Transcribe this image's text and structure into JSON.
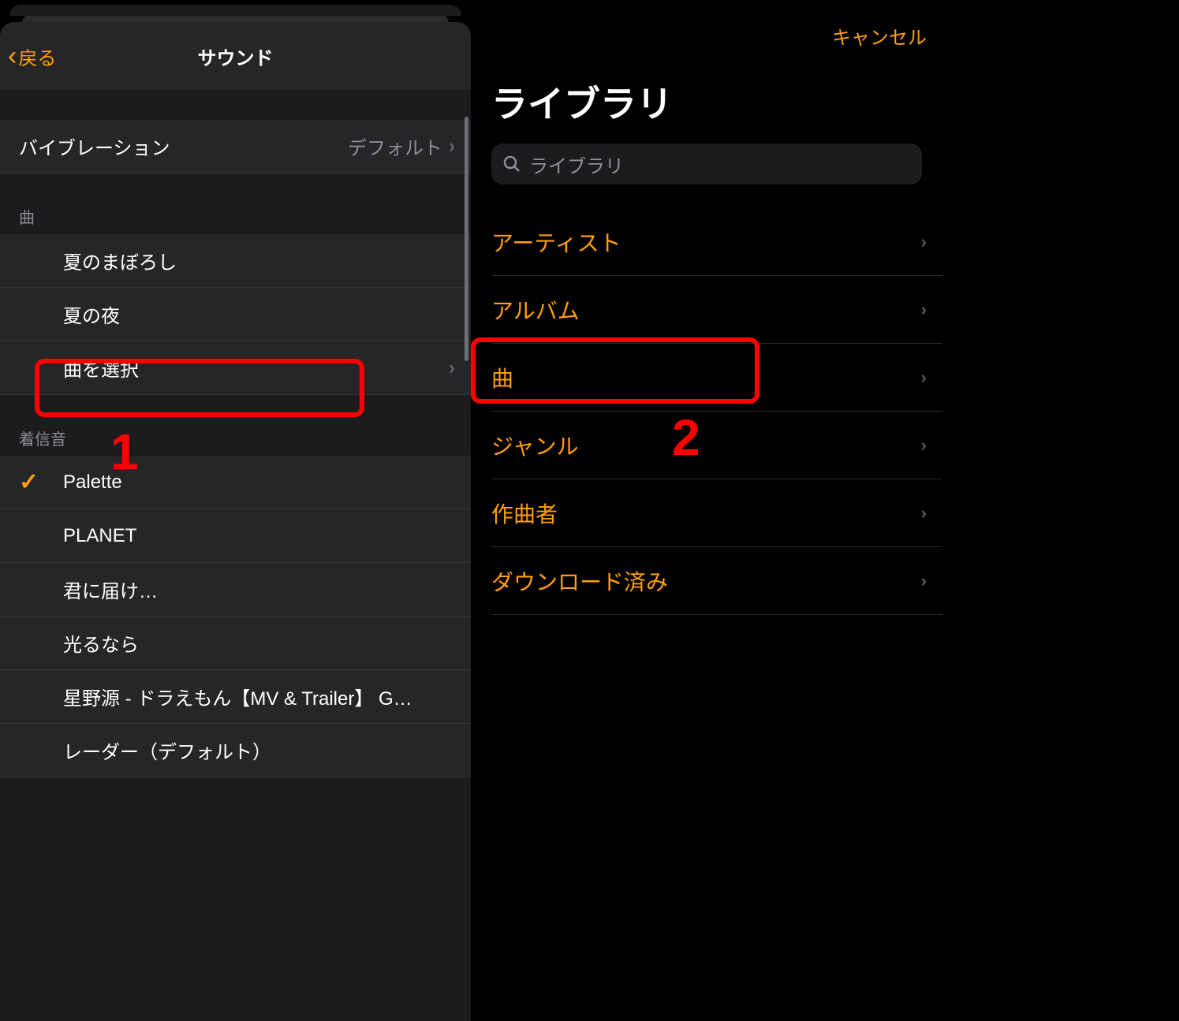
{
  "left": {
    "nav": {
      "back_label": "戻る",
      "title": "サウンド"
    },
    "vibration": {
      "label": "バイブレーション",
      "value": "デフォルト"
    },
    "songs_section": {
      "header": "曲",
      "items": [
        {
          "label": "夏のまぼろし"
        },
        {
          "label": "夏の夜"
        },
        {
          "label": "曲を選択",
          "disclosure": true
        }
      ]
    },
    "ringtones_section": {
      "header": "着信音",
      "items": [
        {
          "label": "Palette",
          "checked": true
        },
        {
          "label": "PLANET"
        },
        {
          "label": "君に届け…"
        },
        {
          "label": "光るなら"
        },
        {
          "label": "星野源 - ドラえもん【MV & Trailer】 G…"
        },
        {
          "label": "レーダー（デフォルト）"
        }
      ]
    }
  },
  "right": {
    "cancel_label": "キャンセル",
    "title": "ライブラリ",
    "search_placeholder": "ライブラリ",
    "items": [
      {
        "label": "アーティスト"
      },
      {
        "label": "アルバム"
      },
      {
        "label": "曲"
      },
      {
        "label": "ジャンル"
      },
      {
        "label": "作曲者"
      },
      {
        "label": "ダウンロード済み"
      }
    ]
  },
  "annotations": {
    "one": "1",
    "two": "2"
  }
}
